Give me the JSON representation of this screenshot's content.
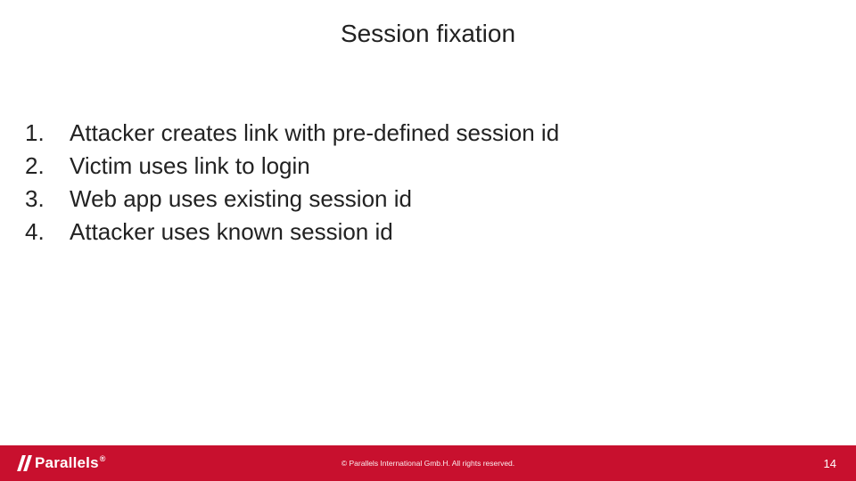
{
  "title": "Session fixation",
  "list": [
    {
      "n": "1.",
      "t": "Attacker creates link with pre-defined session id"
    },
    {
      "n": "2.",
      "t": "Victim uses link to login"
    },
    {
      "n": "3.",
      "t": "Web app uses existing session id"
    },
    {
      "n": "4.",
      "t": "Attacker uses known session id"
    }
  ],
  "footer": {
    "brand": "Parallels",
    "reg": "®",
    "copyright": "© Parallels International Gmb.H. All rights reserved.",
    "page": "14"
  },
  "colors": {
    "accent": "#C8102E"
  }
}
